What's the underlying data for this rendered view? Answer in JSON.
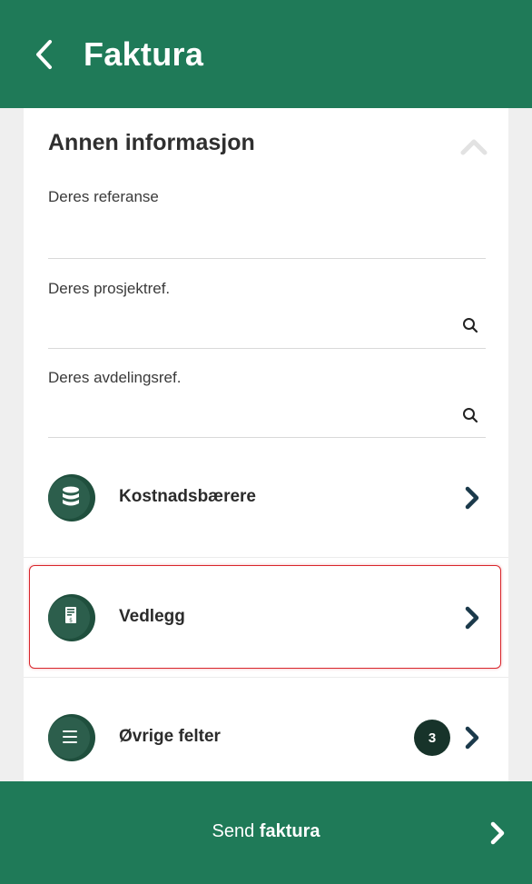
{
  "header": {
    "title": "Faktura",
    "back_icon": "chevron-left-icon"
  },
  "section": {
    "title": "Annen informasjon",
    "collapse_icon": "chevron-up-icon",
    "fields": [
      {
        "label": "Deres referanse",
        "value": "",
        "has_search": false
      },
      {
        "label": "Deres prosjektref.",
        "value": "",
        "has_search": true
      },
      {
        "label": "Deres avdelingsref.",
        "value": "",
        "has_search": true
      }
    ]
  },
  "rows": [
    {
      "label": "Kostnadsbærere",
      "icon": "database-icon"
    },
    {
      "label": "Vedlegg",
      "icon": "invoice-document-icon",
      "highlighted": true
    },
    {
      "label": "Øvrige felter",
      "icon": "menu-lines-icon",
      "badge": "3"
    }
  ],
  "footer": {
    "label_prefix": "Send",
    "label_bold": "faktura",
    "icon": "chevron-right-icon"
  },
  "colors": {
    "brand_green": "#1f7a58",
    "icon_dark_green": "#2c5e4c",
    "chevron_navy": "#1b3a4b",
    "badge_dark": "#17332a",
    "highlight_red": "#d9262c"
  }
}
